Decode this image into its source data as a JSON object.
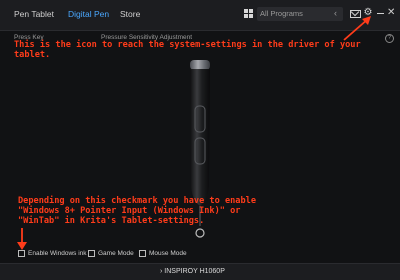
{
  "topbar": {
    "tabs": [
      {
        "label": "Pen Tablet"
      },
      {
        "label": "Digital Pen",
        "active": true
      },
      {
        "label": "Store"
      }
    ],
    "program_select": {
      "value": "All Programs"
    }
  },
  "content": {
    "press_key_label": "Press Key",
    "pressure_label": "Pressure Sensitivity Adjustment",
    "help_symbol": "?"
  },
  "annotations": {
    "top_note": "This is the icon to reach the system-settings in the driver of your tablet.",
    "bottom_note_line1": "Depending on this checkmark you have to enable",
    "bottom_note_line2": "\"Windows 8+ Pointer Input (Windows Ink)\" or",
    "bottom_note_line3": "\"WinTab\" in Krita's Tablet-settings."
  },
  "options": {
    "enable_windows_ink": "Enable Windows ink",
    "game_mode": "Game Mode",
    "mouse_mode": "Mouse Mode"
  },
  "footer": {
    "device_arrow": "›",
    "device_name": "INSPIROY H1060P"
  },
  "colors": {
    "accent": "#4aa8ff",
    "annotation": "#ff3c1a",
    "background": "#111214"
  }
}
